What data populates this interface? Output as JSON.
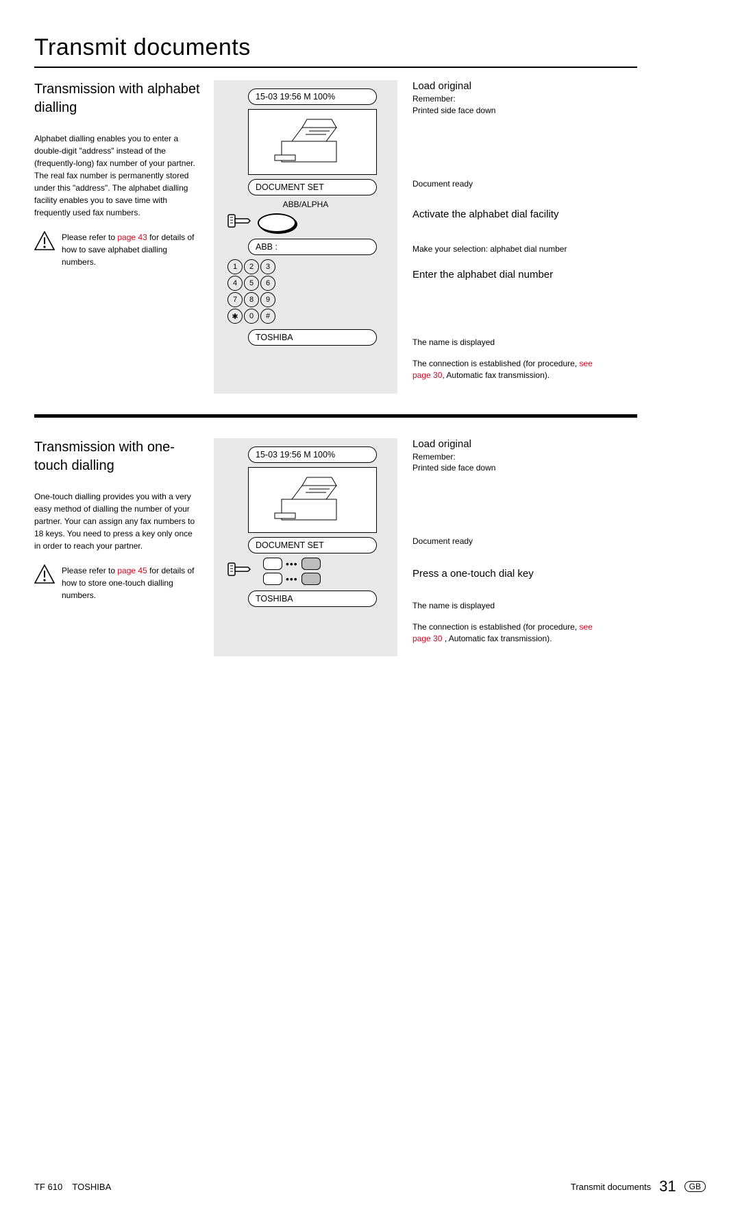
{
  "page_title": "Transmit documents",
  "section1": {
    "heading": "Transmission with alphabet dialling",
    "body": "Alphabet dialling enables you to enter a double-digit \"address\" instead of the (frequently-long) fax number of your partner. The real fax number is permanently stored under this \"address\". The alphabet dialling facility enables you to save time with frequently used fax numbers.",
    "note_pre": "Please refer to ",
    "note_link": "page 43",
    "note_post": " for details of how to save alphabet dialling numbers.",
    "mid": {
      "display_time": "15-03 19:56  M 100%",
      "display_docset": "DOCUMENT SET",
      "btn_label": "ABB/ALPHA",
      "display_abb": "ABB       :",
      "keys": [
        "1",
        "2",
        "3",
        "4",
        "5",
        "6",
        "7",
        "8",
        "9",
        "✱",
        "0",
        "#"
      ],
      "display_name": "TOSHIBA"
    },
    "right": {
      "r1_h": "Load original",
      "r1_s1": "Remember:",
      "r1_s2": "Printed side face down",
      "r2": "Document ready",
      "r3_h": "Activate the alphabet dial facility",
      "r4": "Make your selection: alphabet dial number",
      "r5_h": "Enter the alphabet dial number",
      "r6": "The name is displayed",
      "r7_pre": "The connection is established (for procedure, ",
      "r7_link": "see page 30",
      "r7_post": ", Automatic fax transmission)."
    }
  },
  "section2": {
    "heading": "Transmission with one-touch dialling",
    "body": "One-touch dialling provides you with a very easy method of dialling the number of your partner. Your can assign any fax numbers to 18 keys. You need to press a key only once in order to reach your partner.",
    "note_pre": "Please refer to ",
    "note_link": "page 45",
    "note_post": " for details of how to store one-touch dialling numbers.",
    "mid": {
      "display_time": "15-03 19:56  M 100%",
      "display_docset": "DOCUMENT SET",
      "display_name": "TOSHIBA"
    },
    "right": {
      "r1_h": "Load original",
      "r1_s1": "Remember:",
      "r1_s2": "Printed side face down",
      "r2": "Document ready",
      "r3_h": "Press a one-touch dial key",
      "r4": "The name is displayed",
      "r5_pre": "The connection is established (for procedure, ",
      "r5_link": "see page 30",
      "r5_post": " , Automatic fax transmission)."
    }
  },
  "footer": {
    "model": "TF 610",
    "brand": "TOSHIBA",
    "section": "Transmit documents",
    "page": "31",
    "lang": "GB"
  }
}
